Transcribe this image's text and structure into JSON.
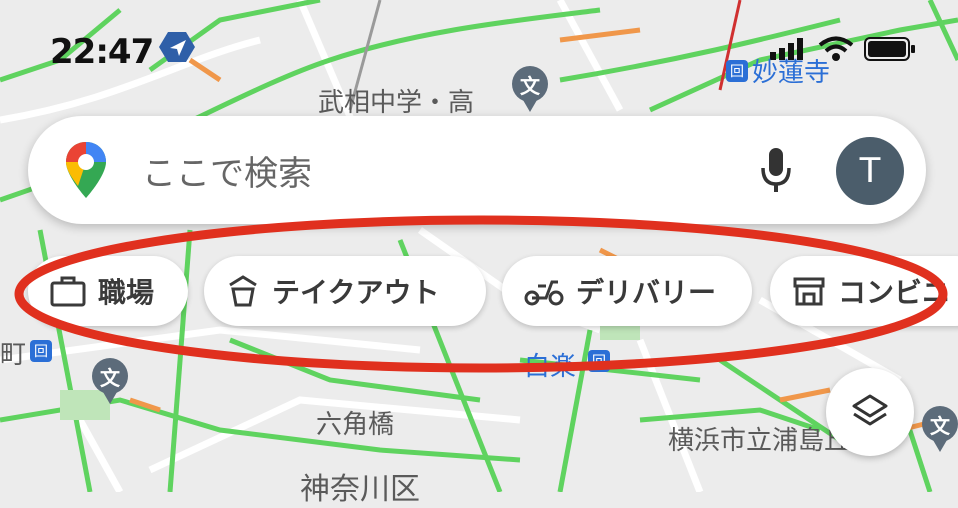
{
  "status_bar": {
    "time": "22:47"
  },
  "map_labels": {
    "school_top": "武相中学・高",
    "station_top": "妙蓮寺",
    "station_mid": "白楽",
    "town_left": "町",
    "bridge": "六角橋",
    "school_right": "横浜市立浦島丘中",
    "ward": "神奈川区"
  },
  "poi_glyph": "文",
  "station_glyph": "回",
  "search": {
    "placeholder": "ここで検索",
    "avatar_letter": "T"
  },
  "chips": [
    {
      "label": "職場",
      "icon": "briefcase-icon"
    },
    {
      "label": "テイクアウト",
      "icon": "takeout-icon"
    },
    {
      "label": "デリバリー",
      "icon": "scooter-icon"
    },
    {
      "label": "コンビニ",
      "icon": "convenience-store-icon"
    }
  ],
  "colors": {
    "traffic_green": "#5fd35f",
    "traffic_orange": "#f0974a",
    "annotation_red": "#e0301e",
    "poi_gray": "#5c6b7a",
    "station_blue": "#2b6fd6"
  }
}
